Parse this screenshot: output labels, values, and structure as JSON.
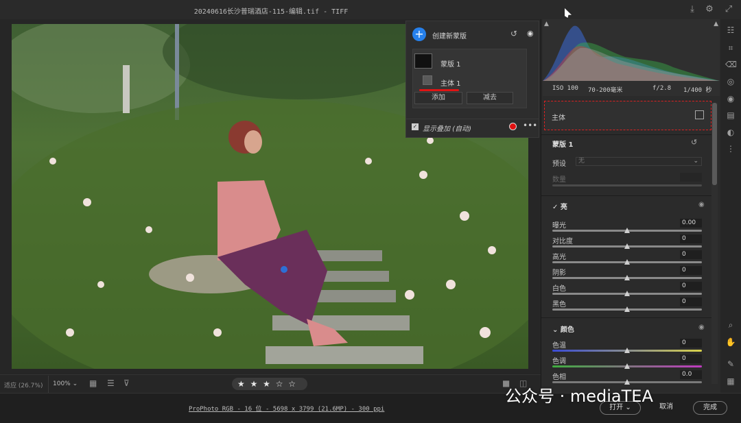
{
  "window": {
    "title": "20240616长沙普瑞酒店-115-编辑.tif -   TIFF"
  },
  "mask_panel": {
    "create_label": "创建新蒙版",
    "mask_name": "蒙版 1",
    "subject_name": "主体 1",
    "add_label": "添加",
    "subtract_label": "减去",
    "overlay_label": "显示叠加 (自动)",
    "overlay_color": "#e01010"
  },
  "meta": {
    "iso": "ISO 100",
    "lens": "70-200毫米",
    "aperture": "f/2.8",
    "shutter": "1/400 秒"
  },
  "properties": {
    "subject_label": "主体",
    "mask_title": "蒙版 1",
    "preset_label": "预设",
    "preset_value": "无",
    "amount_label": "数量"
  },
  "light": {
    "title": "亮",
    "rows": [
      {
        "label": "曝光",
        "value": "0.00"
      },
      {
        "label": "对比度",
        "value": "0"
      },
      {
        "label": "高光",
        "value": "0"
      },
      {
        "label": "阴影",
        "value": "0"
      },
      {
        "label": "白色",
        "value": "0"
      },
      {
        "label": "黑色",
        "value": "0"
      }
    ]
  },
  "color": {
    "title": "颜色",
    "rows": [
      {
        "label": "色温",
        "value": "0"
      },
      {
        "label": "色调",
        "value": "0"
      },
      {
        "label": "色相",
        "value": "0.0"
      }
    ]
  },
  "bottom": {
    "fit_label": "适应 (26.7%)",
    "zoom_value": "100%",
    "rating_stars": "★ ★ ★ ☆ ☆"
  },
  "footer": {
    "info": "ProPhoto RGB - 16 位 - 5698 x 3799 (21.6MP) - 300 ppi",
    "open_label": "打开",
    "cancel_label": "取消",
    "done_label": "完成"
  },
  "watermark": "公众号 · mediaTEA"
}
